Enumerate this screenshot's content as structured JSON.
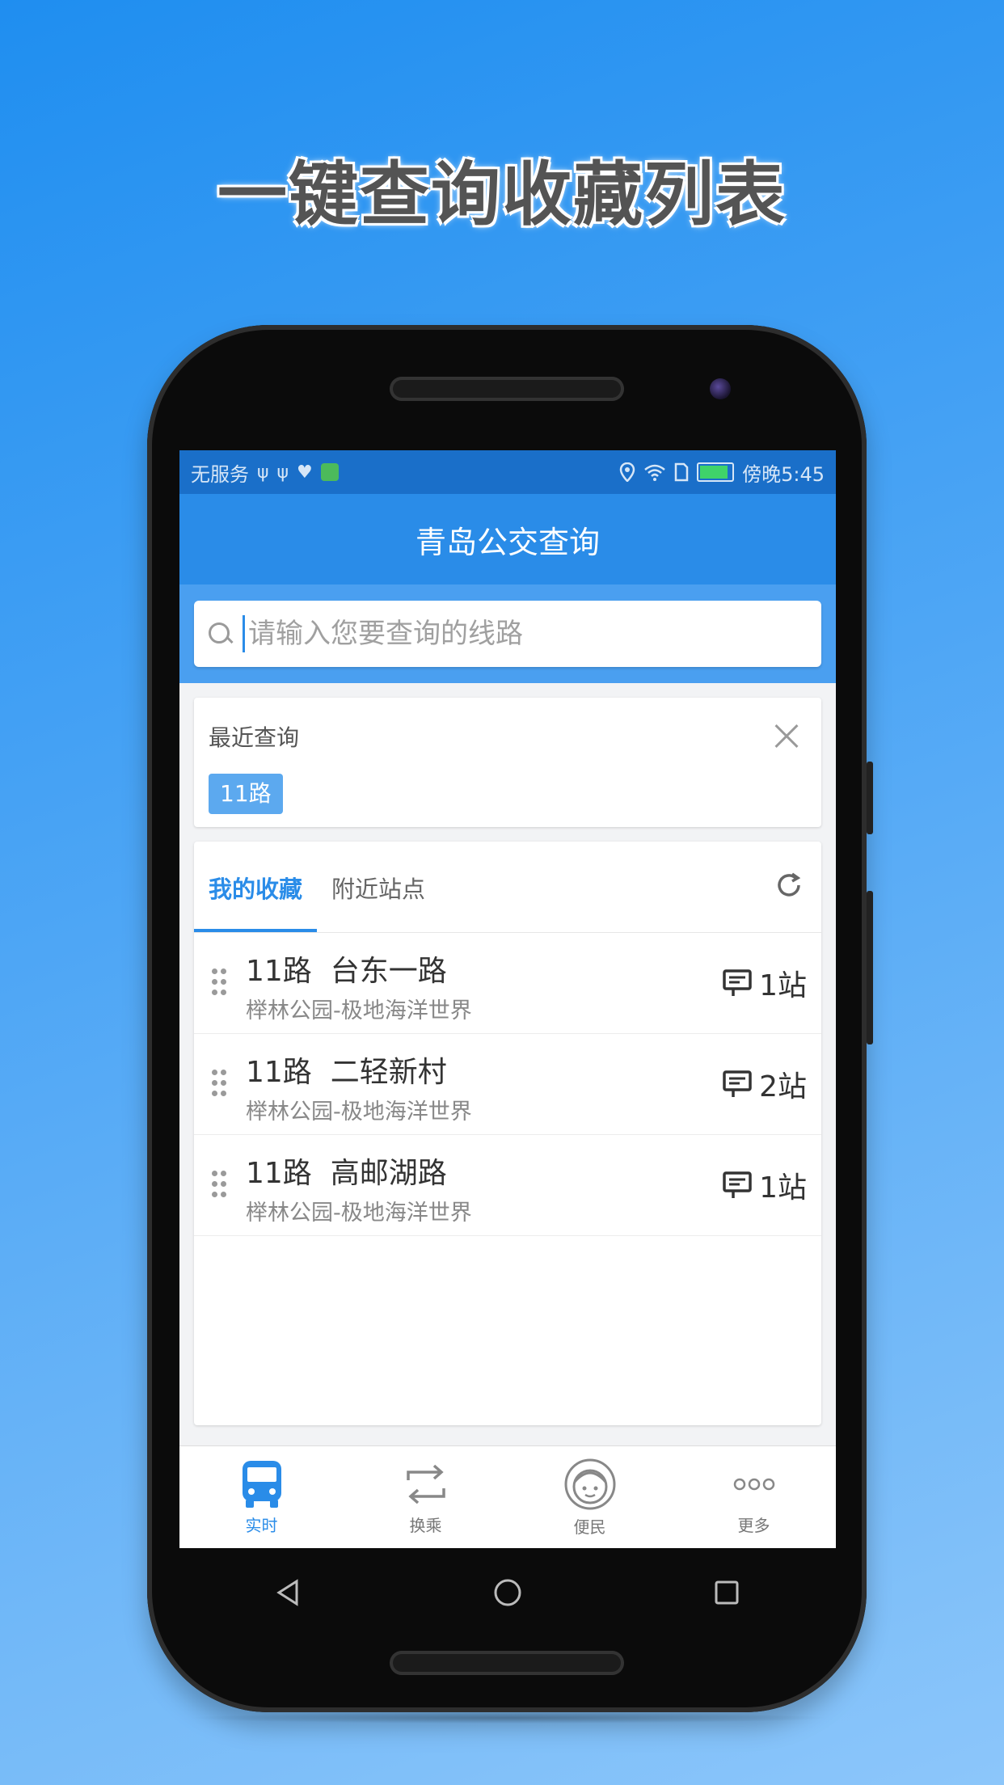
{
  "headline": "一键查询收藏列表",
  "status_bar": {
    "carrier": "无服务",
    "time": "傍晚5:45",
    "left_icons": [
      "usb-icon",
      "usb-icon",
      "heart-monitor-icon",
      "app-notification-icon"
    ],
    "right_icons": [
      "location-icon",
      "wifi-icon",
      "sim-icon",
      "battery-icon"
    ]
  },
  "app": {
    "title": "青岛公交查询",
    "search": {
      "placeholder": "请输入您要查询的线路",
      "value": ""
    },
    "recent": {
      "title": "最近查询",
      "tags": [
        "11路"
      ]
    },
    "tabs": [
      {
        "label": "我的收藏",
        "active": true
      },
      {
        "label": "附近站点",
        "active": false
      }
    ],
    "favorites": [
      {
        "route": "11路",
        "stop": "台东一路",
        "direction": "榉林公园-极地海洋世界",
        "count": "1站"
      },
      {
        "route": "11路",
        "stop": "二轻新村",
        "direction": "榉林公园-极地海洋世界",
        "count": "2站"
      },
      {
        "route": "11路",
        "stop": "高邮湖路",
        "direction": "榉林公园-极地海洋世界",
        "count": "1站"
      }
    ],
    "bottom_nav": [
      {
        "label": "实时",
        "icon": "bus-icon",
        "active": true
      },
      {
        "label": "换乘",
        "icon": "transfer-icon",
        "active": false
      },
      {
        "label": "便民",
        "icon": "face-icon",
        "active": false
      },
      {
        "label": "更多",
        "icon": "more-icon",
        "active": false
      }
    ]
  },
  "colors": {
    "primary": "#2a8ce8",
    "status_bar": "#1a6fc9",
    "tag": "#5ca9ef"
  }
}
